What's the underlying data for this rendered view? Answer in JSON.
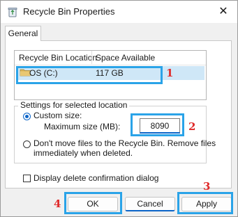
{
  "window": {
    "title": "Recycle Bin Properties",
    "close_glyph": "✕"
  },
  "tabs": [
    "General"
  ],
  "list": {
    "columns": [
      "Recycle Bin Location",
      "Space Available"
    ],
    "rows": [
      {
        "location": "OS (C:)",
        "space": "117 GB"
      }
    ]
  },
  "settings": {
    "group_label": "Settings for selected location",
    "custom_size_label": "Custom size:",
    "max_size_label": "Maximum size (MB):",
    "max_size_value": "8090",
    "dont_move_label_line1": "Don't move files to the Recycle Bin. Remove files",
    "dont_move_label_line2": "immediately when deleted.",
    "selected_option": "custom_size"
  },
  "confirm_dialog_label": "Display delete confirmation dialog",
  "confirm_dialog_checked": false,
  "buttons": {
    "ok": "OK",
    "cancel": "Cancel",
    "apply": "Apply"
  },
  "annotations": {
    "n1": "1",
    "n2": "2",
    "n3": "3",
    "n4": "4"
  },
  "colors": {
    "highlight": "#2aa3e8",
    "annotation_number": "#e02a2a",
    "accent": "#0a64c8"
  }
}
